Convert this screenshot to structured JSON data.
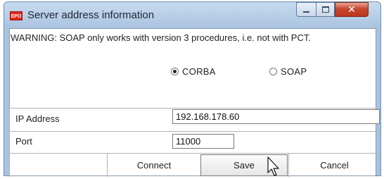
{
  "window": {
    "title": "Server address information",
    "app_icon_text": "EPO",
    "controls": {
      "minimize": "minimize-icon",
      "maximize": "maximize-icon",
      "close": "close-icon"
    }
  },
  "warning_text": "WARNING: SOAP only works with version 3 procedures, i.e. not with PCT.",
  "protocol": {
    "options": [
      {
        "label": "CORBA",
        "checked": true
      },
      {
        "label": "SOAP",
        "checked": false
      }
    ]
  },
  "fields": {
    "ip_address": {
      "label": "IP Address",
      "value": "192.168.178.60"
    },
    "port": {
      "label": "Port",
      "value": "11000"
    }
  },
  "buttons": {
    "connect": "Connect",
    "save": "Save",
    "cancel": "Cancel"
  },
  "colors": {
    "titlebar": "#bcd2e9",
    "close_button": "#c8472f",
    "app_icon": "#e1251b"
  }
}
